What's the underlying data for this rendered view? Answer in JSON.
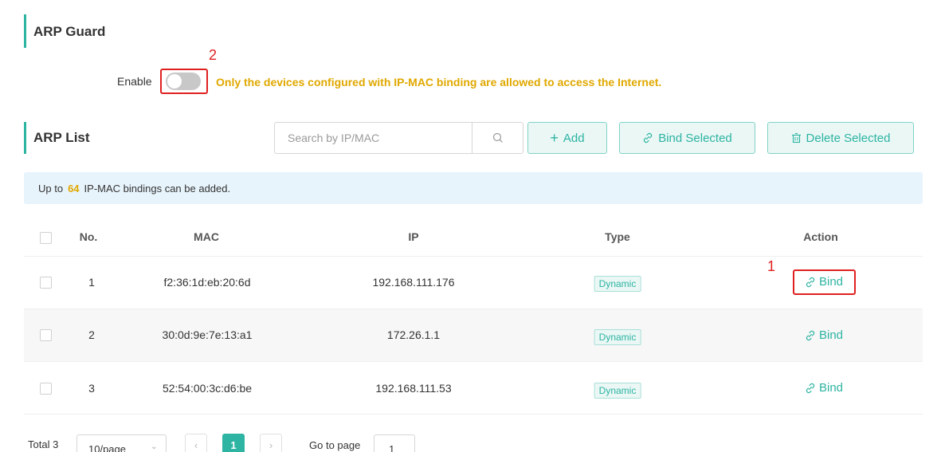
{
  "arp_guard": {
    "title": "ARP Guard",
    "enable_label": "Enable",
    "enabled": false,
    "hint": "Only the devices configured with IP-MAC binding are allowed to access the Internet."
  },
  "annotations": {
    "toggle_number": "2",
    "bind_number": "1",
    "color": "#e02020"
  },
  "arp_list": {
    "title": "ARP List",
    "search_placeholder": "Search by IP/MAC",
    "buttons": {
      "add": "Add",
      "bind_selected": "Bind Selected",
      "delete_selected": "Delete Selected"
    },
    "notice": {
      "prefix": "Up to",
      "count": "64",
      "suffix": "IP-MAC bindings can be added."
    },
    "columns": {
      "no": "No.",
      "mac": "MAC",
      "ip": "IP",
      "type": "Type",
      "action": "Action"
    },
    "rows": [
      {
        "no": "1",
        "mac": "f2:36:1d:eb:20:6d",
        "ip": "192.168.111.176",
        "type": "Dynamic",
        "action": "Bind"
      },
      {
        "no": "2",
        "mac": "30:0d:9e:7e:13:a1",
        "ip": "172.26.1.1",
        "type": "Dynamic",
        "action": "Bind"
      },
      {
        "no": "3",
        "mac": "52:54:00:3c:d6:be",
        "ip": "192.168.111.53",
        "type": "Dynamic",
        "action": "Bind"
      }
    ]
  },
  "pagination": {
    "total": "Total 3",
    "page_size": "10/page",
    "current_page": "1",
    "goto_label": "Go to page",
    "goto_value": "1"
  },
  "colors": {
    "accent": "#2db4a2",
    "warning": "#e0a800",
    "notice_bg": "#e8f4fc"
  },
  "icons": [
    "plus-icon",
    "link-icon",
    "trash-icon",
    "search-icon",
    "chevron-down-icon",
    "chevron-left-icon",
    "chevron-right-icon"
  ]
}
